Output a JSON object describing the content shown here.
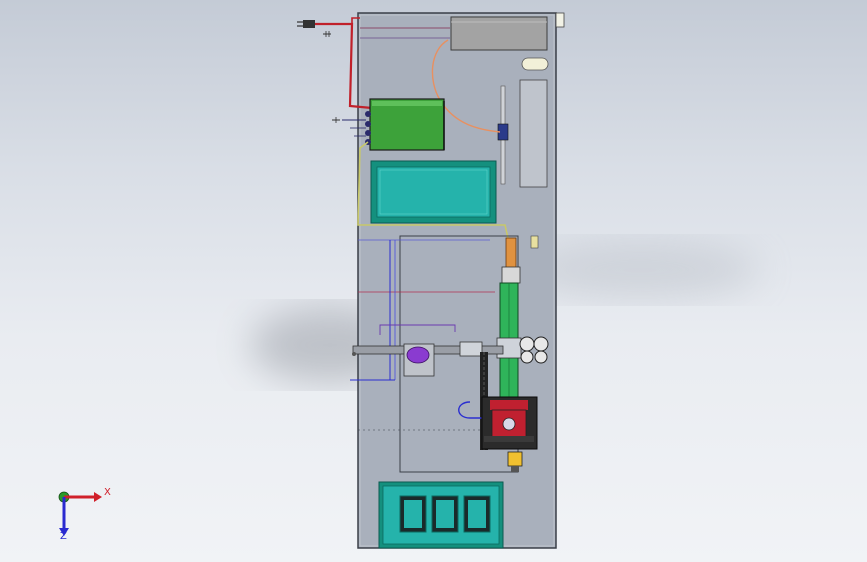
{
  "colors": {
    "background_top": "#c4cbd6",
    "background_bottom": "#f1f3f6",
    "panel": "#a9b0bc",
    "panel_edge": "#3a3f48",
    "green_component": "#3da23a",
    "teal_component": "#25b3ab",
    "teal_border": "#14907e",
    "power_box": "#a3a3a3",
    "linear_rail": "#2fb45a",
    "red_wire": "#c0202a",
    "blue_wire": "#2a2ed0",
    "yellow_wire": "#c8c86a",
    "orange_cable": "#e89060",
    "purple_part": "#8a3bd0",
    "axis_x": "#d0202a",
    "axis_y": "#2a9a2a",
    "axis_z": "#2a2ad0"
  },
  "triad": {
    "x_label": "X",
    "z_label": "Z"
  }
}
